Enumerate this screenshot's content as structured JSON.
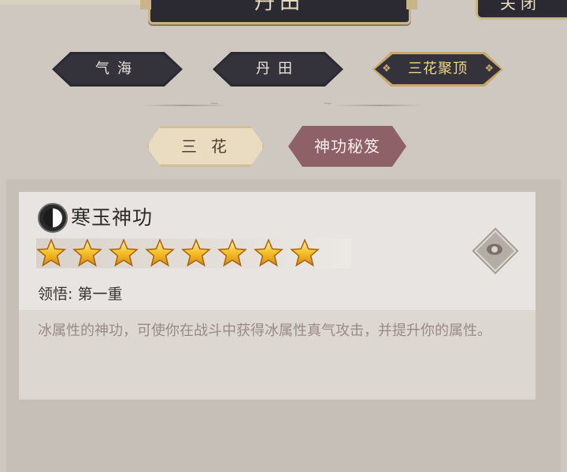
{
  "header": {
    "title": "丹田",
    "side_button": "关闭"
  },
  "tabs": [
    {
      "label": "气海",
      "active": false
    },
    {
      "label": "丹田",
      "active": false
    },
    {
      "label": "三花聚顶",
      "active": true
    }
  ],
  "sub_tabs": [
    {
      "label": "三花",
      "active": false
    },
    {
      "label": "神功秘笈",
      "active": true
    }
  ],
  "skill": {
    "icon": "yin-yang-icon",
    "name": "寒玉神功",
    "stars": 8,
    "realm_label": "领悟:",
    "realm_value": "第一重",
    "description": "冰属性的神功，可使你在战斗中获得冰属性真气攻击，并提升你的属性。"
  },
  "colors": {
    "accent_gold": "#c8a868",
    "active_subtab": "#8e6068",
    "desc_text": "#9a8a84"
  }
}
